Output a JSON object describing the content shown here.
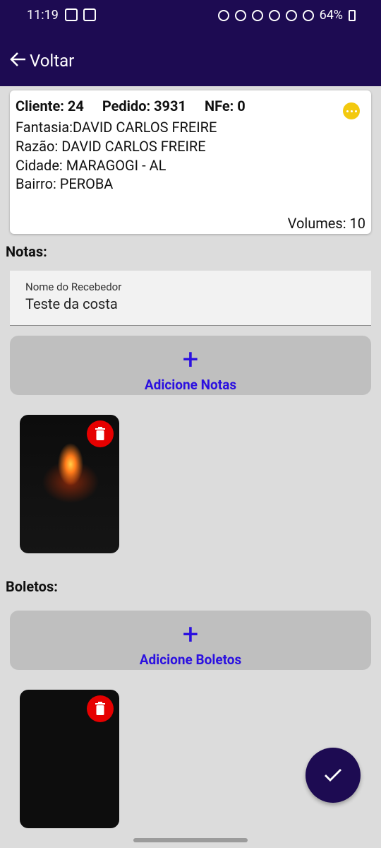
{
  "status_bar": {
    "time": "11:19",
    "battery": "64%"
  },
  "app_bar": {
    "back_label": "Voltar"
  },
  "card": {
    "cliente": "Cliente: 24",
    "pedido": "Pedido: 3931",
    "nfe": "NFe: 0",
    "fantasia": "Fantasia:DAVID CARLOS FREIRE",
    "razao": "Razão: DAVID CARLOS FREIRE",
    "cidade": "Cidade: MARAGOGI - AL",
    "bairro": "Bairro: PEROBA",
    "volumes": "Volumes: 10"
  },
  "notas": {
    "section_label": "Notas:",
    "input_label": "Nome do Recebedor",
    "input_value": "Teste da costa",
    "add_button": "Adicione Notas"
  },
  "boletos": {
    "section_label": "Boletos:",
    "add_button": "Adicione Boletos"
  },
  "colors": {
    "primary": "#1d0b52",
    "accent": "#2b10e0",
    "danger": "#e60000",
    "menu": "#f3c90f"
  }
}
